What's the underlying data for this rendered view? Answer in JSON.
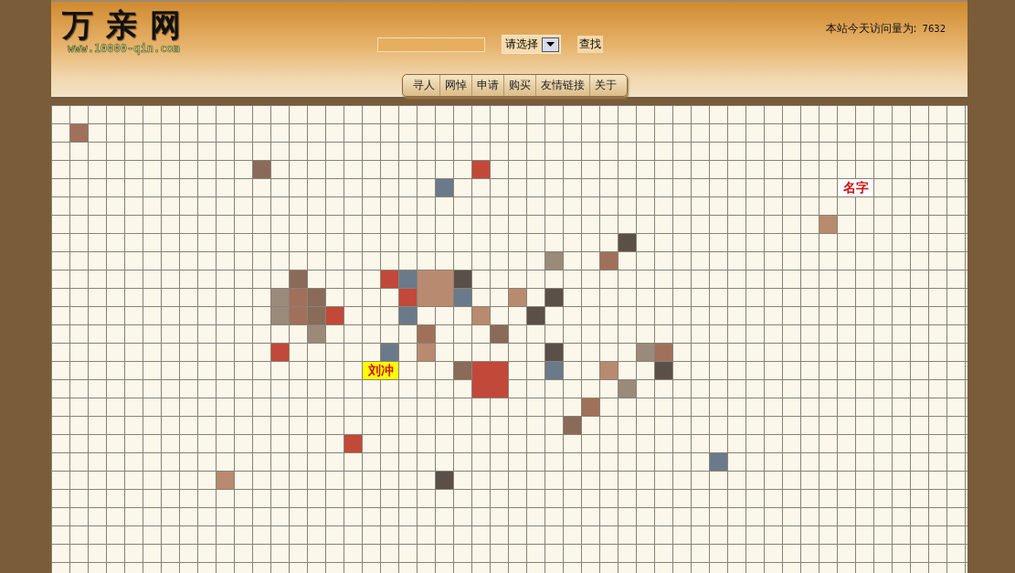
{
  "logo": {
    "title": "万亲网",
    "url": "www.10000-qin.com"
  },
  "search": {
    "dropdown": "请选择",
    "button": "查找"
  },
  "visit_counter": {
    "label": "本站今天访问量为:",
    "value": "7632"
  },
  "nav": [
    "寻人",
    "网悼",
    "申请",
    "购买",
    "友情链接",
    "关于"
  ],
  "name_tags": [
    {
      "text": "刘冲",
      "kind": "highlight"
    },
    {
      "text": "名字",
      "kind": "plain"
    }
  ]
}
